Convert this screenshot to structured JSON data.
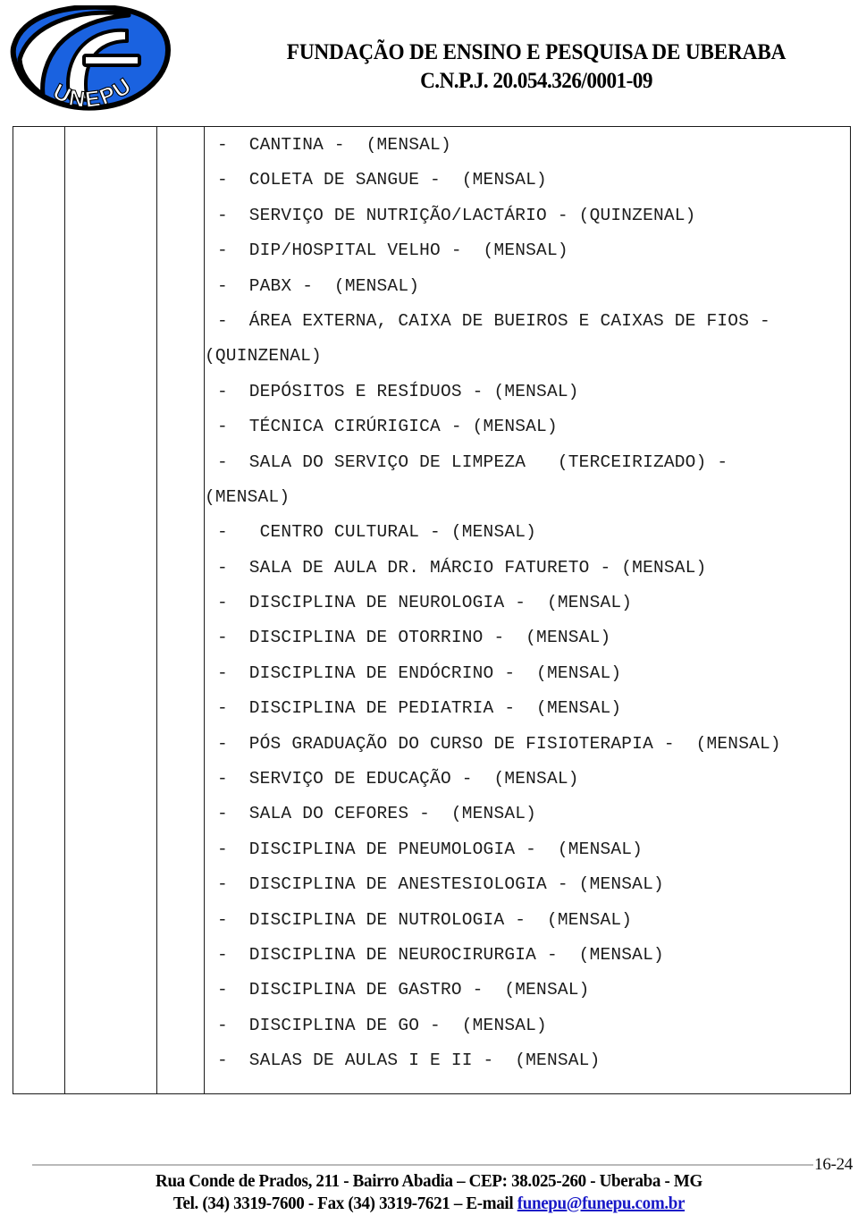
{
  "letterhead": {
    "logo": {
      "icon_name": "funepu-logo",
      "wordmark": "UNEPU",
      "letter": "F",
      "brand_blue": "#1a62e0",
      "outline": "#000000"
    },
    "org_name": "FUNDAÇÃO DE ENSINO E PESQUISA DE UBERABA",
    "org_cnpj": "C.N.P.J. 20.054.326/0001-09"
  },
  "table": {
    "columns": [
      {
        "name": "col-1",
        "value": ""
      },
      {
        "name": "col-2",
        "value": ""
      },
      {
        "name": "col-3",
        "value": ""
      },
      {
        "name": "col-4-items",
        "value": ""
      }
    ],
    "items": [
      {
        "text": "-  CANTINA -  (MENSAL)",
        "style": "ind"
      },
      {
        "text": "-  COLETA DE SANGUE -  (MENSAL)",
        "style": "ind"
      },
      {
        "text": "-  SERVIÇO DE NUTRIÇÃO/LACTÁRIO - (QUINZENAL)",
        "style": "ind"
      },
      {
        "text": "-  DIP/HOSPITAL VELHO -  (MENSAL)",
        "style": "ind"
      },
      {
        "text": "-  PABX -  (MENSAL)",
        "style": "ind"
      },
      {
        "text": "-  ÁREA EXTERNA, CAIXA DE BUEIROS E CAIXAS DE FIOS -",
        "style": "ind"
      },
      {
        "text": "(QUINZENAL)",
        "style": "cont"
      },
      {
        "text": "-  DEPÓSITOS E RESÍDUOS - (MENSAL)",
        "style": "ind"
      },
      {
        "text": "-  TÉCNICA CIRÚRIGICA - (MENSAL)",
        "style": "ind"
      },
      {
        "text": "-  SALA DO SERVIÇO DE LIMPEZA   (TERCEIRIZADO) -",
        "style": "ind"
      },
      {
        "text": "(MENSAL)",
        "style": "cont"
      },
      {
        "text": "-   CENTRO CULTURAL - (MENSAL)",
        "style": "ind"
      },
      {
        "text": "-  SALA DE AULA DR. MÁRCIO FATURETO - (MENSAL)",
        "style": "ind"
      },
      {
        "text": "-  DISCIPLINA DE NEUROLOGIA -  (MENSAL)",
        "style": "ind"
      },
      {
        "text": "-  DISCIPLINA DE OTORRINO -  (MENSAL)",
        "style": "ind"
      },
      {
        "text": "-  DISCIPLINA DE ENDÓCRINO -  (MENSAL)",
        "style": "ind"
      },
      {
        "text": "-  DISCIPLINA DE PEDIATRIA -  (MENSAL)",
        "style": "ind"
      },
      {
        "text": "-  PÓS GRADUAÇÃO DO CURSO DE FISIOTERAPIA -  (MENSAL)",
        "style": "ind"
      },
      {
        "text": "-  SERVIÇO DE EDUCAÇÃO -  (MENSAL)",
        "style": "ind"
      },
      {
        "text": "-  SALA DO CEFORES -  (MENSAL)",
        "style": "ind"
      },
      {
        "text": "-  DISCIPLINA DE PNEUMOLOGIA -  (MENSAL)",
        "style": "ind"
      },
      {
        "text": "-  DISCIPLINA DE ANESTESIOLOGIA - (MENSAL)",
        "style": "ind"
      },
      {
        "text": "-  DISCIPLINA DE NUTROLOGIA -  (MENSAL)",
        "style": "ind"
      },
      {
        "text": "-  DISCIPLINA DE NEUROCIRURGIA -  (MENSAL)",
        "style": "ind"
      },
      {
        "text": "-  DISCIPLINA DE GASTRO -  (MENSAL)",
        "style": "ind"
      },
      {
        "text": "-  DISCIPLINA DE GO -  (MENSAL)",
        "style": "ind"
      },
      {
        "text": "-  SALAS DE AULAS I E II -  (MENSAL)",
        "style": "ind"
      }
    ]
  },
  "footer": {
    "address_line": "Rua Conde de Prados, 211 - Bairro Abadia – CEP:  38.025-260 - Uberaba - MG",
    "contact_prefix": "Tel. (34) 3319-7600 - Fax (34) 3319-7621 – E-mail ",
    "email": "funepu@funepu.com.br",
    "page_number": "16-24",
    "email_color": "#1919c8"
  }
}
